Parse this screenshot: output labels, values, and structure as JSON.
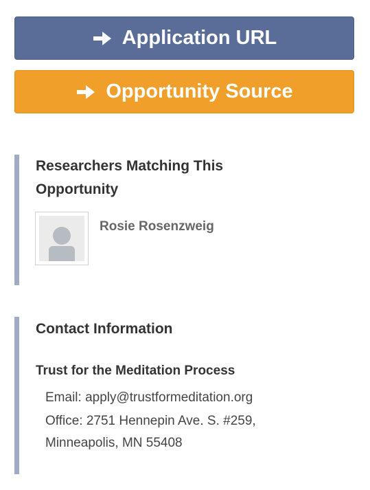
{
  "buttons": {
    "application_url": {
      "label": "Application URL",
      "icon": "arrow-right-icon",
      "color": "#5a6d98"
    },
    "opportunity_source": {
      "label": "Opportunity Source",
      "icon": "arrow-right-icon",
      "color": "#f0a02a"
    }
  },
  "researchers": {
    "heading": "Researchers Matching This Opportunity",
    "items": [
      {
        "name": "Rosie Rosenzweig",
        "avatar_icon": "default-avatar-icon"
      }
    ]
  },
  "contact": {
    "heading": "Contact Information",
    "organization": "Trust for the Meditation Process",
    "email_line": "Email: apply@trustformeditation.org",
    "office_line_1": "Office: 2751 Hennepin Ave. S. #259,",
    "office_line_2": "Minneapolis, MN 55408"
  },
  "colors": {
    "panel_border": "#a1aac6"
  }
}
